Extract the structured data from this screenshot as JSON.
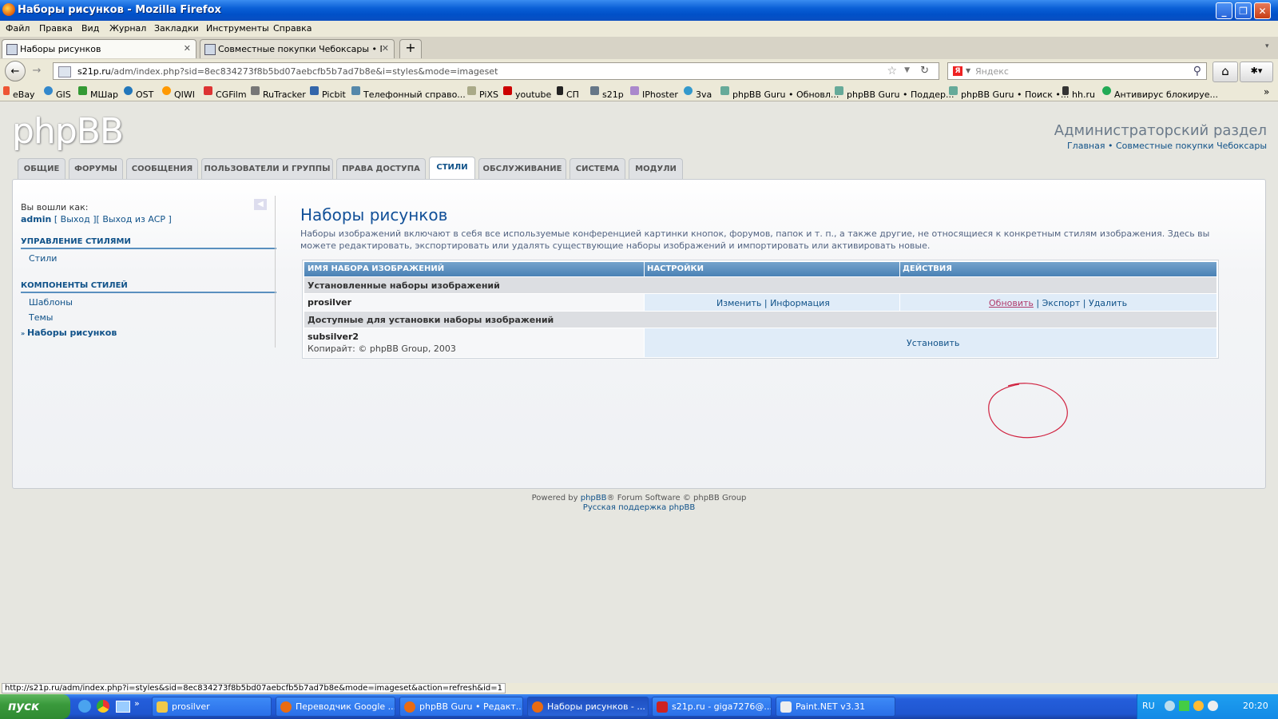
{
  "window": {
    "title": "Наборы рисунков - Mozilla Firefox"
  },
  "menu": [
    "Файл",
    "Правка",
    "Вид",
    "Журнал",
    "Закладки",
    "Инструменты",
    "Справка"
  ],
  "tabs": [
    {
      "label": "Наборы рисунков"
    },
    {
      "label": "Совместные покупки Чебоксары • Про..."
    }
  ],
  "nav": {
    "url_host": "s21p.ru",
    "url_path": "/adm/index.php?sid=8ec834273f8b5bd07aebcfb5b7ad7b8e&i=styles&mode=imageset",
    "search_placeholder": "Яндекс"
  },
  "bookmarks": [
    "eBay",
    "GIS",
    "МШар",
    "OST",
    "QIWI",
    "CGFilm",
    "RuTracker",
    "Picbit",
    "Телефонный справо...",
    "PiXS",
    "youtube",
    "СП",
    "s21p",
    "IPhoster",
    "3va",
    "phpBB Guru • Обновл...",
    "phpBB Guru • Поддер...",
    "phpBB Guru • Поиск •...",
    "hh.ru",
    "Антивирус блокируе..."
  ],
  "acp": {
    "logo": "phpBB",
    "admin_title": "Администраторский раздел",
    "top_links": "Главная • Совместные покупки Чебоксары",
    "nav_tabs": [
      "ОБЩИЕ",
      "ФОРУМЫ",
      "СООБЩЕНИЯ",
      "ПОЛЬЗОВАТЕЛИ И ГРУППЫ",
      "ПРАВА ДОСТУПА",
      "СТИЛИ",
      "ОБСЛУЖИВАНИЕ",
      "СИСТЕМА",
      "МОДУЛИ"
    ],
    "logged_as": "Вы вошли как:",
    "username": "admin",
    "logout_links": "[ Выход ][ Выход из ACP ]",
    "side_sections": [
      {
        "title": "УПРАВЛЕНИЕ СТИЛЯМИ",
        "items": [
          "Стили"
        ]
      },
      {
        "title": "КОМПОНЕНТЫ СТИЛЕЙ",
        "items": [
          "Шаблоны",
          "Темы",
          "Наборы рисунков"
        ]
      }
    ],
    "page_title": "Наборы рисунков",
    "page_desc": "Наборы изображений включают в себя все используемые конференцией картинки кнопок, форумов, папок и т. п., а также другие, не относящиеся к конкретным стилям изображения. Здесь вы можете редактировать, экспортировать или удалять существующие наборы изображений и импортировать или активировать новые.",
    "table": {
      "headers": [
        "ИМЯ НАБОРА ИЗОБРАЖЕНИЙ",
        "НАСТРОЙКИ",
        "ДЕЙСТВИЯ"
      ],
      "installed_header": "Установленные наборы изображений",
      "installed_row": {
        "name": "prosilver",
        "edit": "Изменить",
        "info": "Информация",
        "refresh": "Обновить",
        "export": "Экспорт",
        "delete": "Удалить"
      },
      "available_header": "Доступные для установки наборы изображений",
      "available_row": {
        "name": "subsilver2",
        "copyright": "Копирайт: © phpBB Group, 2003",
        "install": "Установить"
      }
    },
    "footer1a": "Powered by",
    "footer1b": "phpBB",
    "footer1c": "® Forum Software © phpBB Group",
    "footer2": "Русская поддержка phpBB"
  },
  "status_url": "http://s21p.ru/adm/index.php?i=styles&sid=8ec834273f8b5bd07aebcfb5b7ad7b8e&mode=imageset&action=refresh&id=1",
  "taskbar": {
    "start": "пуск",
    "buttons": [
      "prosilver",
      "Переводчик Google ...",
      "phpBB Guru • Редакт...",
      "Наборы рисунков - ...",
      "s21p.ru - giga7276@...",
      "Paint.NET v3.31"
    ],
    "lang": "RU",
    "clock": "20:20"
  }
}
